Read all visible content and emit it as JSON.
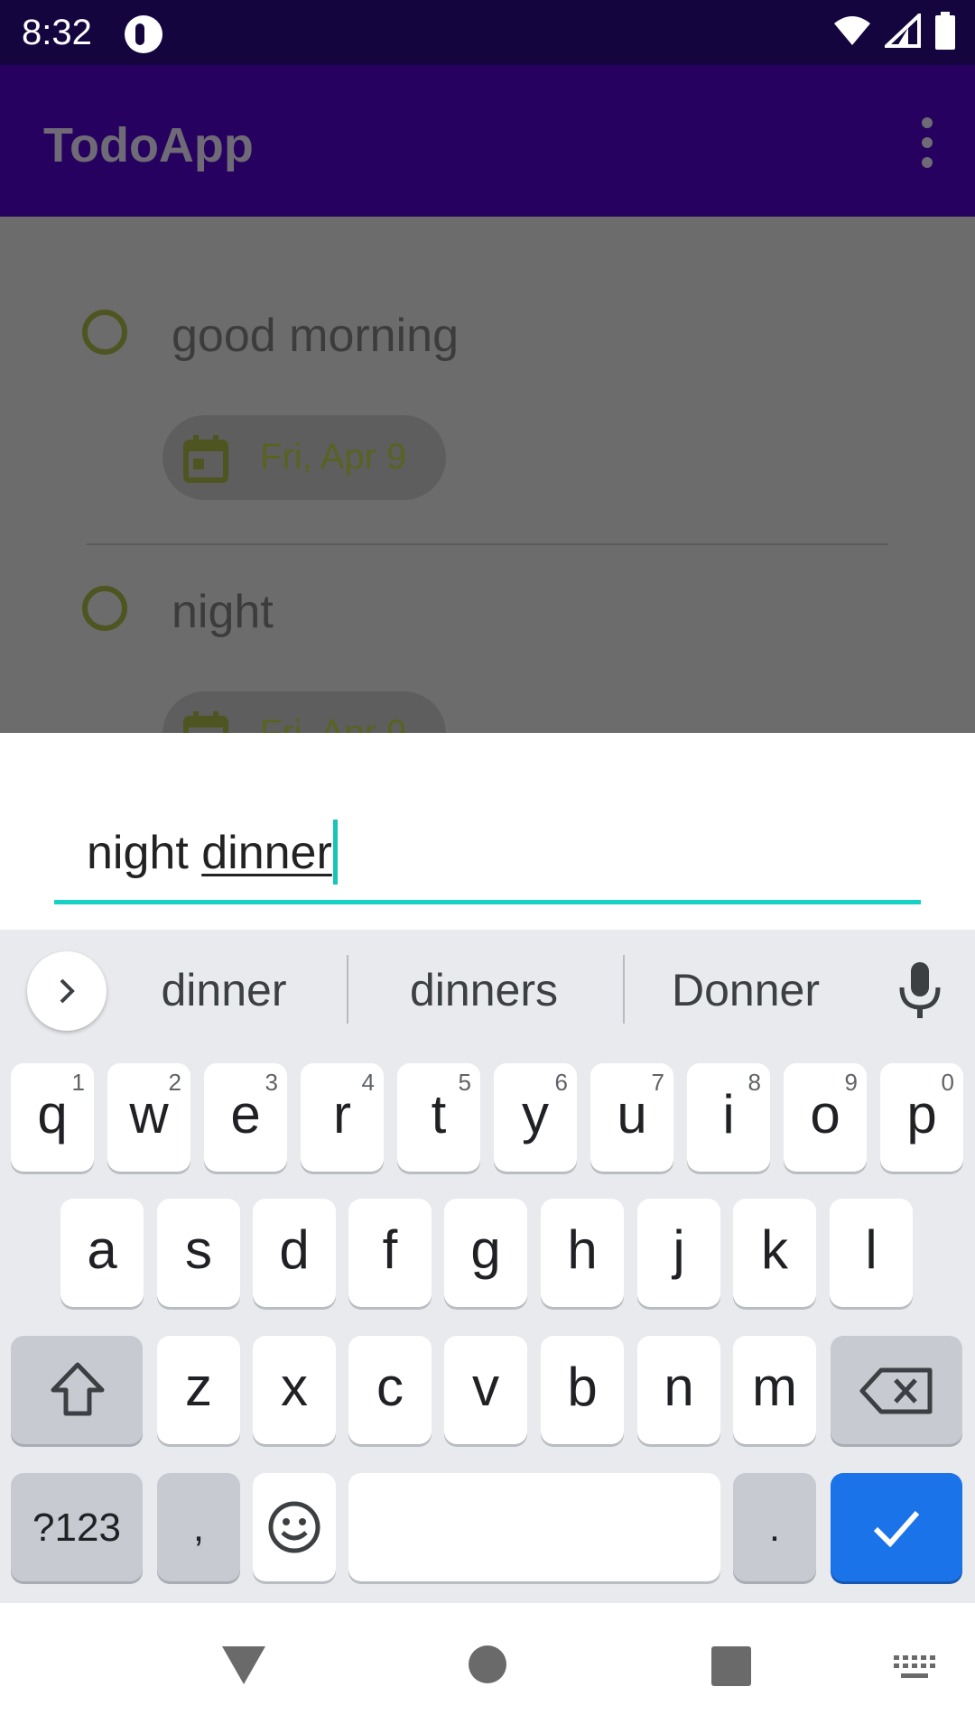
{
  "status_bar": {
    "time": "8:32"
  },
  "app_bar": {
    "title": "TodoApp"
  },
  "tasks": [
    {
      "title": "good morning",
      "date": "Fri, Apr 9"
    },
    {
      "title": "night",
      "date": "Fri, Apr 9"
    }
  ],
  "input": {
    "prefix": "night ",
    "composing": "dinner"
  },
  "suggestions": [
    "dinner",
    "dinners",
    "Donner"
  ],
  "keyboard": {
    "row1": [
      {
        "k": "q",
        "h": "1"
      },
      {
        "k": "w",
        "h": "2"
      },
      {
        "k": "e",
        "h": "3"
      },
      {
        "k": "r",
        "h": "4"
      },
      {
        "k": "t",
        "h": "5"
      },
      {
        "k": "y",
        "h": "6"
      },
      {
        "k": "u",
        "h": "7"
      },
      {
        "k": "i",
        "h": "8"
      },
      {
        "k": "o",
        "h": "9"
      },
      {
        "k": "p",
        "h": "0"
      }
    ],
    "row2": [
      "a",
      "s",
      "d",
      "f",
      "g",
      "h",
      "j",
      "k",
      "l"
    ],
    "row3": [
      "z",
      "x",
      "c",
      "v",
      "b",
      "n",
      "m"
    ],
    "symbols_label": "?123",
    "comma_label": ",",
    "period_label": "."
  },
  "colors": {
    "accent_teal": "#17d2c4",
    "enter_blue": "#1a73e8",
    "app_bar": "#27015f",
    "status_bar": "#14053f"
  },
  "icons": [
    "wifi-icon",
    "signal-icon",
    "battery-icon",
    "more-vert-icon",
    "calendar-icon",
    "chevron-right-icon",
    "microphone-icon",
    "shift-icon",
    "backspace-icon",
    "emoji-icon",
    "check-icon",
    "nav-back-icon",
    "nav-home-icon",
    "nav-recents-icon",
    "keyboard-icon"
  ]
}
